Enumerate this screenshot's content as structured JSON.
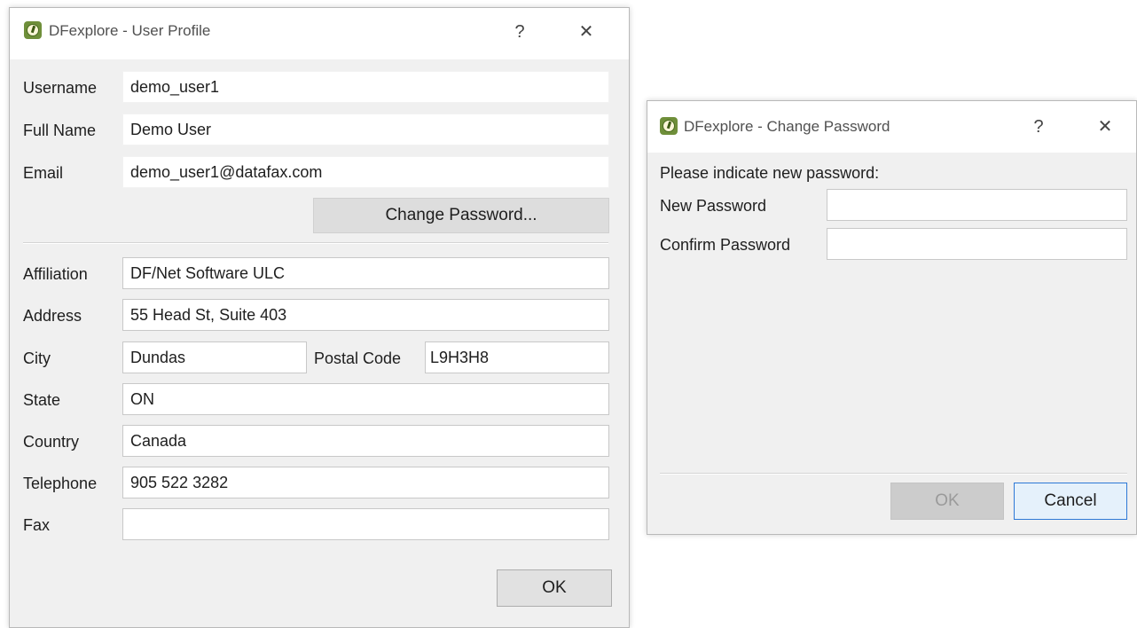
{
  "profile_dialog": {
    "title": "DFexplore - User Profile",
    "help_glyph": "?",
    "close_glyph": "✕",
    "icon": "dfexplore-app-icon",
    "fields": {
      "username": {
        "label": "Username",
        "value": "demo_user1"
      },
      "full_name": {
        "label": "Full Name",
        "value": "Demo User"
      },
      "email": {
        "label": "Email",
        "value": "demo_user1@datafax.com"
      },
      "affiliation": {
        "label": "Affiliation",
        "value": "DF/Net Software ULC"
      },
      "address": {
        "label": "Address",
        "value": "55 Head St, Suite 403"
      },
      "city": {
        "label": "City",
        "value": "Dundas"
      },
      "postal_code": {
        "label": "Postal Code",
        "value": "L9H3H8"
      },
      "state": {
        "label": "State",
        "value": "ON"
      },
      "country": {
        "label": "Country",
        "value": "Canada"
      },
      "telephone": {
        "label": "Telephone",
        "value": "905 522 3282"
      },
      "fax": {
        "label": "Fax",
        "value": ""
      }
    },
    "change_password_label": "Change Password...",
    "ok_label": "OK"
  },
  "password_dialog": {
    "title": "DFexplore - Change Password",
    "help_glyph": "?",
    "close_glyph": "✕",
    "icon": "dfexplore-app-icon",
    "prompt": "Please indicate new password:",
    "new_password_label": "New Password",
    "new_password_value": "",
    "confirm_password_label": "Confirm Password",
    "confirm_password_value": "",
    "ok_label": "OK",
    "cancel_label": "Cancel"
  },
  "colors": {
    "dialog_background": "#f0f0f0",
    "title_background": "#ffffff",
    "focus_border": "#2d78d6",
    "app_icon": "#6f8f3a"
  }
}
